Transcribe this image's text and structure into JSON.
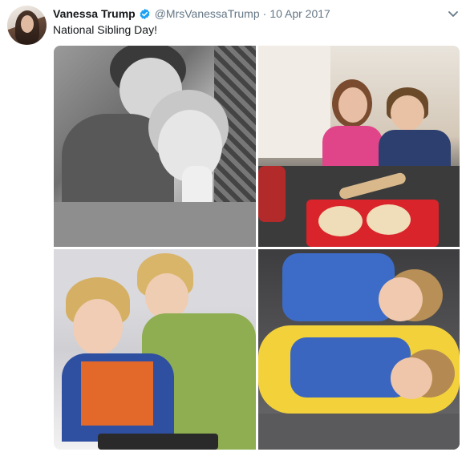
{
  "tweet": {
    "display_name": "Vanessa Trump",
    "handle": "@MrsVanessaTrump",
    "separator": "·",
    "date": "10 Apr 2017",
    "text": "National Sibling Day!",
    "verified": true,
    "accent_color": "#1da1f2"
  },
  "icons": {
    "verified": "verified-badge-icon",
    "menu": "chevron-down-icon"
  },
  "media": {
    "photos": [
      {
        "name": "sibling-photo-black-white"
      },
      {
        "name": "sibling-photo-kitchen-baking"
      },
      {
        "name": "sibling-photo-bed-tablet"
      },
      {
        "name": "sibling-photo-yellow-chair"
      }
    ]
  }
}
